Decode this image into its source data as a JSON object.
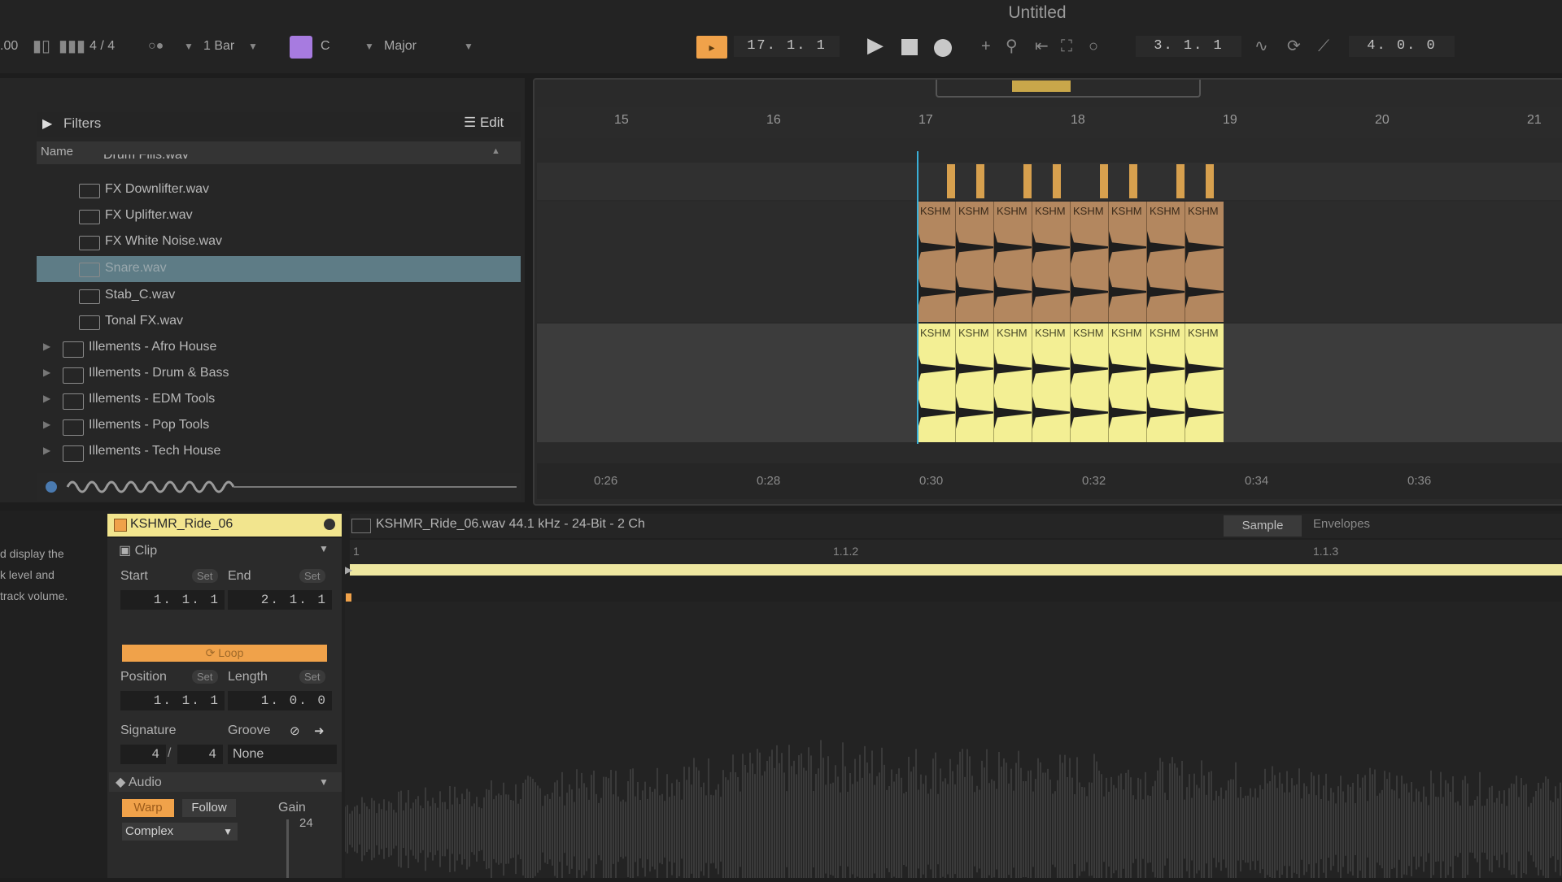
{
  "top_bar": {
    "title": "Untitled",
    "tempo_fragment": ".00",
    "time_signature": "4 / 4",
    "quantize": "1 Bar",
    "key": "C",
    "scale": "Major",
    "position": "17.  1.  1",
    "loop_start": "3.  1.  1",
    "loop_length": "4.  0.  0"
  },
  "browser": {
    "filters_label": "Filters",
    "edit_label": "Edit",
    "name_header": "Name",
    "cut_item": "Drum Fills.wav",
    "files": [
      "FX Downlifter.wav",
      "FX Uplifter.wav",
      "FX White Noise.wav",
      "Snare.wav",
      "Stab_C.wav",
      "Tonal FX.wav"
    ],
    "selected_file": "Snare.wav",
    "folders": [
      "Illements - Afro House",
      "Illements - Drum & Bass",
      "Illements - EDM Tools",
      "Illements - Pop Tools",
      "Illements - Tech House"
    ]
  },
  "arrangement": {
    "bars": [
      "15",
      "16",
      "17",
      "18",
      "19",
      "20",
      "21"
    ],
    "times": [
      "0:26",
      "0:28",
      "0:30",
      "0:32",
      "0:34",
      "0:36"
    ],
    "clip_label": "KSHM",
    "clip_count": 8,
    "colors": {
      "audio_clip_1": "#b3875f",
      "audio_clip_2": "#f3ef94",
      "accent": "#f0a24a"
    }
  },
  "detail": {
    "info_text": [
      "d display the",
      "k level and",
      "track volume."
    ],
    "clip_name": "KSHMR_Ride_06",
    "clip_section": "Clip",
    "start_label": "Start",
    "end_label": "End",
    "set_label": "Set",
    "start_value": "1.  1.  1",
    "end_value": "2.  1.  1",
    "loop_label": "Loop",
    "position_label": "Position",
    "length_label": "Length",
    "position_value": "1.  1.  1",
    "length_value": "1.  0.  0",
    "signature_label": "Signature",
    "groove_label": "Groove",
    "sig_num": "4",
    "sig_den": "4",
    "groove_value": "None",
    "audio_section": "Audio",
    "warp_label": "Warp",
    "follow_label": "Follow",
    "warp_mode": "Complex",
    "gain_label": "Gain",
    "gain_value": "24",
    "sample_file": "KSHMR_Ride_06.wav  44.1 kHz - 24-Bit - 2 Ch",
    "tab_sample": "Sample",
    "tab_envelopes": "Envelopes",
    "ruler_marks": [
      "1",
      "1.1.2",
      "1.1.3"
    ]
  }
}
